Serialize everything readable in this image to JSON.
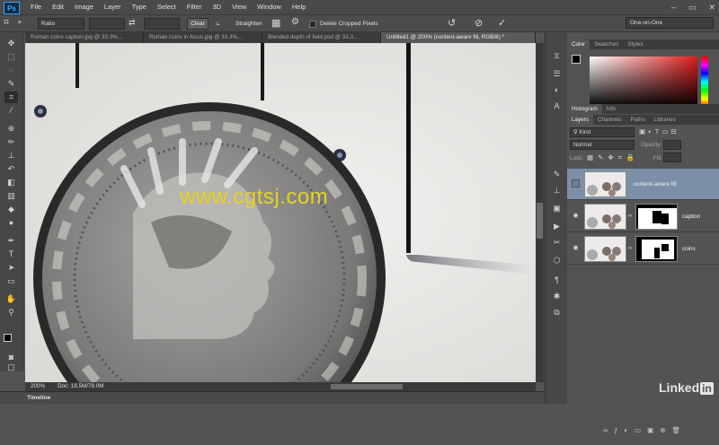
{
  "app": {
    "logo": "Ps"
  },
  "menu": [
    "File",
    "Edit",
    "Image",
    "Layer",
    "Type",
    "Select",
    "Filter",
    "3D",
    "View",
    "Window",
    "Help"
  ],
  "window_controls": [
    "–",
    "▭",
    "✕"
  ],
  "options": {
    "ratio": "Ratio",
    "clear": "Clear",
    "straighten": "Straighten",
    "delete_cropped": "Delete Cropped Pixels",
    "workspace": "One-on-One"
  },
  "doc_tabs": [
    {
      "label": "Roman coins caption.jpg @ 33.3%...",
      "active": false
    },
    {
      "label": "Roman coins in focus.jpg @ 33.3%...",
      "active": false
    },
    {
      "label": "Blended depth of field.psd @ 33.3...",
      "active": false
    },
    {
      "label": "Untitled1 @ 200% (content-aware fill, RGB/8) *",
      "active": true
    }
  ],
  "status": {
    "zoom": "200%",
    "doc": "Doc: 18.5M/78.0M"
  },
  "timeline": "Timeline",
  "color_panel": {
    "tabs": [
      "Color",
      "Swatches",
      "Styles"
    ],
    "accent": "#e01c1c"
  },
  "histogram_tabs": [
    "Histogram",
    "Info"
  ],
  "layers_panel": {
    "tabs": [
      "Layers",
      "Channels",
      "Paths",
      "Libraries"
    ],
    "kind": "Kind",
    "blend": "Normal",
    "opacity_label": "Opacity:",
    "lock_label": "Lock:",
    "fill_label": "Fill:",
    "layers": [
      {
        "name": "content-aware fill",
        "selected": true,
        "visible": false
      },
      {
        "name": "caption",
        "selected": false,
        "visible": true
      },
      {
        "name": "coins",
        "selected": false,
        "visible": true
      }
    ]
  },
  "watermark": "www.cgtsj.com",
  "brand": "Linked"
}
